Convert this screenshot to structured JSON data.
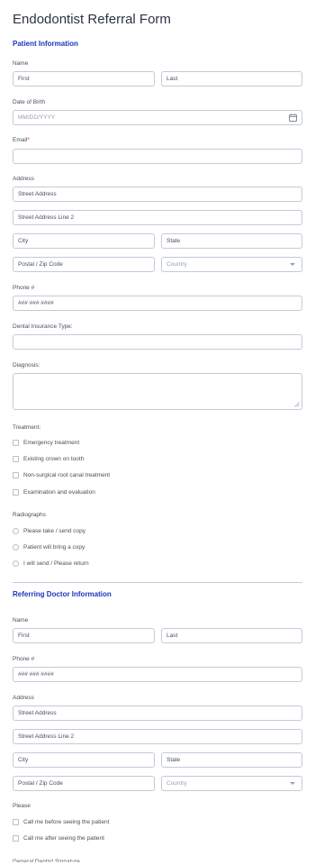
{
  "form": {
    "title": "Endodontist Referral Form"
  },
  "patient": {
    "section_title": "Patient Information",
    "name": {
      "label": "Name",
      "first": "First",
      "last": "Last"
    },
    "dob": {
      "label": "Date of Birth",
      "placeholder": "MM/DD/YYYY",
      "icon": "calendar-icon"
    },
    "email": {
      "label": "Email",
      "required_mark": "*",
      "value": ""
    },
    "address": {
      "label": "Address",
      "street": "Street Address",
      "street2": "Street Address Line 2",
      "city": "City",
      "state": "State",
      "postal": "Postal / Zip Code",
      "country": "Country"
    },
    "phone": {
      "label": "Phone #",
      "value": "### ### ####"
    },
    "insurance": {
      "label": "Dental Insurance Type:",
      "value": ""
    },
    "diagnosis": {
      "label": "Diagnosis:",
      "value": ""
    },
    "treatment": {
      "label": "Treatment:",
      "options": [
        "Emergency treatment",
        "Existing crown on tooth",
        "Non-surgical root canal treatment",
        "Examination and evaluation"
      ]
    },
    "radiographs": {
      "label": "Radiographs",
      "options": [
        "Please take / send copy",
        "Patient will bring a copy",
        "I will send / Please return"
      ]
    }
  },
  "doctor": {
    "section_title": "Referring Doctor Information",
    "name": {
      "label": "Name",
      "first": "First",
      "last": "Last"
    },
    "phone": {
      "label": "Phone #",
      "value": "### ### ####"
    },
    "address": {
      "label": "Address",
      "street": "Street Address",
      "street2": "Street Address Line 2",
      "city": "City",
      "state": "State",
      "postal": "Postal / Zip Code",
      "country": "Country"
    },
    "please": {
      "label": "Please",
      "options": [
        "Call me before seeing the patient",
        "Call me after seeing the patient"
      ]
    },
    "partial_label": "General Dentist Signature"
  },
  "colors": {
    "section": "#1a35c0",
    "required": "#e2231a",
    "border": "#c3cad8"
  }
}
